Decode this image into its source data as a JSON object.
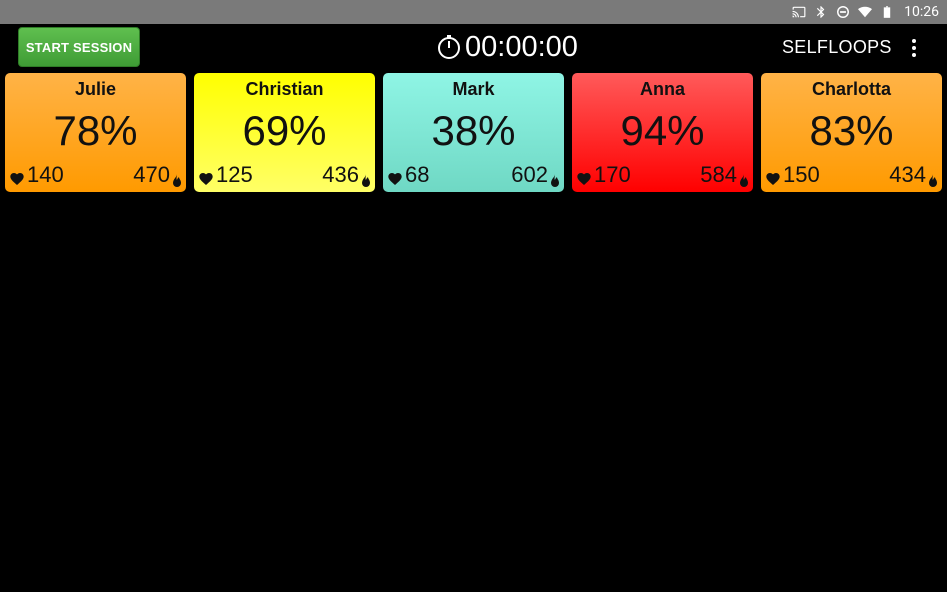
{
  "status_bar": {
    "time": "10:26",
    "icons": [
      "cast-icon",
      "bluetooth-icon",
      "do-not-disturb-icon",
      "wifi-icon",
      "battery-icon"
    ]
  },
  "app_bar": {
    "start_label": "START SESSION",
    "timer": "00:00:00",
    "brand": "SELFLOOPS"
  },
  "tiles": [
    {
      "name": "Julie",
      "pct": "78%",
      "hr": "140",
      "cal": "470",
      "color_top": "#ffb347",
      "color_bottom": "#ff9a00"
    },
    {
      "name": "Christian",
      "pct": "69%",
      "hr": "125",
      "cal": "436",
      "color_top": "#ffff00",
      "color_bottom": "#ffff66"
    },
    {
      "name": "Mark",
      "pct": "38%",
      "hr": "68",
      "cal": "602",
      "color_top": "#8ff5e5",
      "color_bottom": "#6fd8c4"
    },
    {
      "name": "Anna",
      "pct": "94%",
      "hr": "170",
      "cal": "584",
      "color_top": "#ff5a5a",
      "color_bottom": "#ff0000"
    },
    {
      "name": "Charlotta",
      "pct": "83%",
      "hr": "150",
      "cal": "434",
      "color_top": "#ffb347",
      "color_bottom": "#ff9a00"
    }
  ]
}
